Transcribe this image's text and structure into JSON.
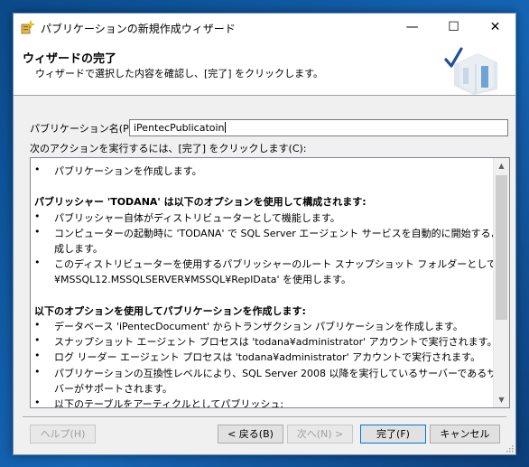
{
  "window": {
    "title": "パブリケーションの新規作成ウィザード",
    "min_glyph": "—",
    "max_glyph": "☐",
    "close_glyph": "✕"
  },
  "header": {
    "title": "ウィザードの完了",
    "subtitle": "ウィザードで選択した内容を確認し、[完了] をクリックします。"
  },
  "form": {
    "name_label": "パブリケーション名(P):",
    "name_value": "iPentecPublicatoin",
    "actions_label": "次のアクションを実行するには、[完了] をクリックします(C):"
  },
  "actions": {
    "bullet": "•",
    "lines": [
      {
        "kind": "bullet",
        "text": "パブリケーションを作成します。"
      },
      {
        "kind": "blank",
        "text": ""
      },
      {
        "kind": "heading",
        "text": "パブリッシャー 'TODANA' は以下のオプションを使用して構成されます:"
      },
      {
        "kind": "bullet",
        "text": "パブリッシャー自体がディストリビューターとして機能します。"
      },
      {
        "kind": "bullet",
        "text": "コンピューターの起動時に 'TODANA' で SQL Server エージェント サービスを自動的に開始するように構"
      },
      {
        "kind": "cont",
        "text": "成します。"
      },
      {
        "kind": "bullet",
        "text": "このディストリビューターを使用するパブリッシャーのルート スナップショット フォルダーとして 'D:¥SQL Server"
      },
      {
        "kind": "cont",
        "text": "¥MSSQL12.MSSQLSERVER¥MSSQL¥ReplData' を使用します。"
      },
      {
        "kind": "blank",
        "text": ""
      },
      {
        "kind": "heading",
        "text": "以下のオプションを使用してパブリケーションを作成します:"
      },
      {
        "kind": "bullet",
        "text": "データベース 'iPentecDocument' からトランザクション パブリケーションを作成します。"
      },
      {
        "kind": "bullet",
        "text": "スナップショット エージェント プロセスは 'todana¥administrator' アカウントで実行されます。"
      },
      {
        "kind": "bullet",
        "text": "ログ リーダー エージェント プロセスは 'todana¥administrator' アカウントで実行されます。"
      },
      {
        "kind": "bullet",
        "text": "パブリケーションの互換性レベルにより、SQL Server 2008 以降を実行しているサーバーであるサブスクライ"
      },
      {
        "kind": "cont",
        "text": "バーがサポートされます。"
      },
      {
        "kind": "bullet",
        "text": "以下のテーブルをアーティクルとしてパブリッシュ:"
      }
    ]
  },
  "buttons": {
    "help": "ヘルプ(H)",
    "back": "< 戻る(B)",
    "next": "次へ(N) >",
    "finish": "完了(F)",
    "cancel": "キャンセル"
  }
}
